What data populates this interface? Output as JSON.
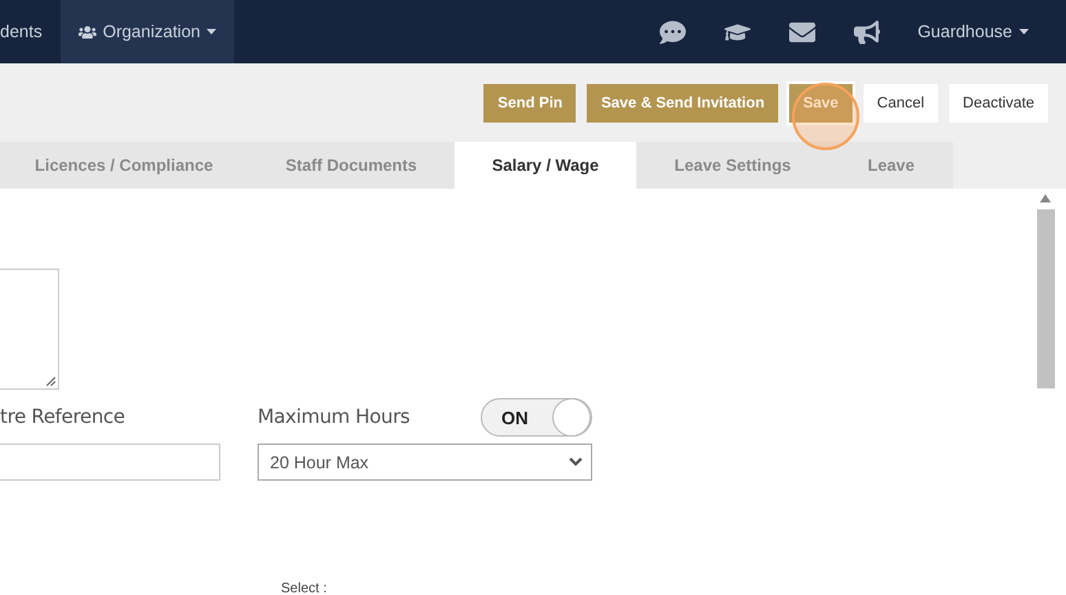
{
  "navbar": {
    "links": [
      {
        "label": "dents",
        "kind": "link",
        "selected": false
      },
      {
        "label": "Organization",
        "kind": "dropdown",
        "selected": true
      }
    ],
    "user": {
      "label": "Guardhouse"
    }
  },
  "actions": [
    {
      "label": "Send Pin",
      "kind": "primary",
      "focused": false
    },
    {
      "label": "Save & Send Invitation",
      "kind": "primary",
      "focused": false
    },
    {
      "label": "Save",
      "kind": "primary",
      "focused": true
    },
    {
      "label": "Cancel",
      "kind": "default",
      "focused": false
    },
    {
      "label": "Deactivate",
      "kind": "default",
      "focused": false
    }
  ],
  "tabs": [
    {
      "label": "Licences / Compliance",
      "selected": false
    },
    {
      "label": "Staff Documents",
      "selected": false
    },
    {
      "label": "Salary / Wage",
      "selected": true
    },
    {
      "label": "Leave Settings",
      "selected": false
    },
    {
      "label": "Leave",
      "selected": false
    }
  ],
  "form": {
    "reference": {
      "label": "tre Reference"
    },
    "max_hours": {
      "label": "Maximum Hours",
      "toggle": {
        "label": "ON",
        "on": true
      },
      "value": "20 Hour Max"
    },
    "select_label": "Select :"
  }
}
